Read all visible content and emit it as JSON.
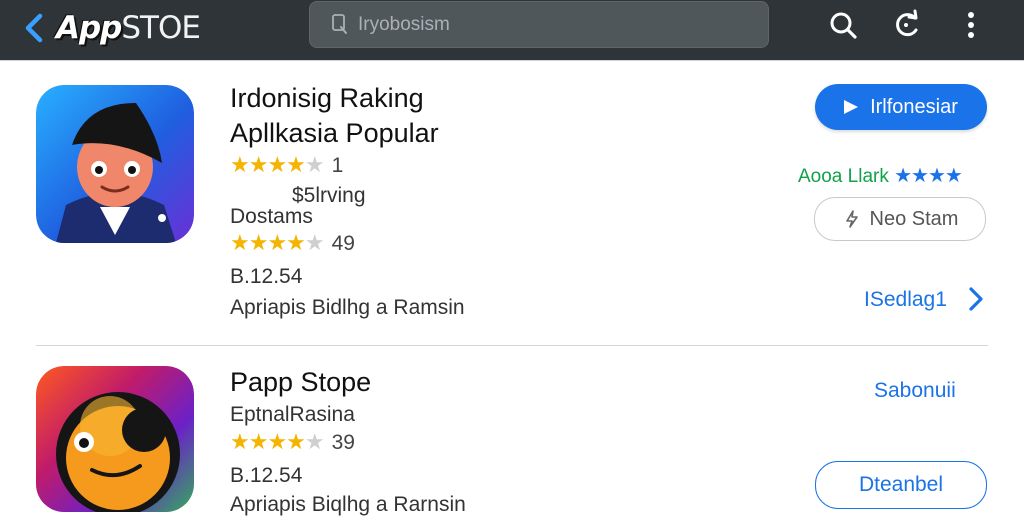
{
  "topbar": {
    "brand_part1": "App",
    "brand_part2": "STOE",
    "search_placeholder": "Iryobosism",
    "back_icon": "chevron-left-icon",
    "actions": [
      "search-icon",
      "refresh-icon",
      "more-vert-icon"
    ]
  },
  "apps": [
    {
      "name_line1": "Irdonisig Raking",
      "name_line2": "Apllkasia Popular",
      "rating1": {
        "stars": 4,
        "count": "1"
      },
      "price": "$5lrving",
      "category": "Dostams",
      "rating2": {
        "stars": 4,
        "count": "49"
      },
      "version": "B.12.54",
      "description": "Apriapis Bidlhg a Ramsin",
      "primary_button": "Irlfonesiar",
      "side_label": "Aooa Llark",
      "side_stars": "★★★★",
      "outline_button": "Neo Stam",
      "link": "ISedlag1"
    },
    {
      "name": "Papp Stope",
      "category": "EptnalRasina",
      "rating": {
        "stars": 4,
        "count": "39"
      },
      "version": "B.12.54",
      "description": "Apriapis Biqlhg a Rarnsin",
      "link": "Sabonuii",
      "outline_button": "Dteanbel"
    }
  ],
  "colors": {
    "topbar_bg": "#2e3438",
    "accent_blue": "#1a73e8",
    "star_gold": "#f4b400",
    "green": "#12a14b"
  }
}
